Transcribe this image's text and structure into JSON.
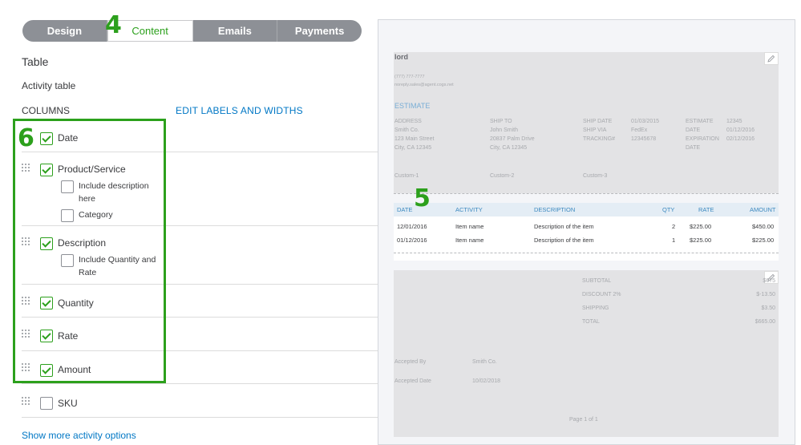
{
  "tabs": [
    {
      "label": "Design"
    },
    {
      "label": "Content"
    },
    {
      "label": "Emails"
    },
    {
      "label": "Payments"
    }
  ],
  "callouts": {
    "tabs": "4",
    "table_preview": "5",
    "columns": "6"
  },
  "left": {
    "section_title": "Table",
    "subsection": "Activity table",
    "columns_header": "COLUMNS",
    "edit_link": "EDIT LABELS AND WIDTHS",
    "columns": [
      {
        "label": "Date",
        "checked": true
      },
      {
        "label": "Product/Service",
        "checked": true,
        "sub": [
          {
            "label": "Include description here",
            "checked": false
          },
          {
            "label": "Category",
            "checked": false
          }
        ]
      },
      {
        "label": "Description",
        "checked": true,
        "sub": [
          {
            "label": "Include Quantity and Rate",
            "checked": false
          }
        ]
      },
      {
        "label": "Quantity",
        "checked": true
      },
      {
        "label": "Rate",
        "checked": true
      },
      {
        "label": "Amount",
        "checked": true
      },
      {
        "label": "SKU",
        "checked": false
      }
    ],
    "show_more": "Show more activity options"
  },
  "preview": {
    "company": "lord",
    "phone": "(777) 777-7777",
    "email": "noreply.sales@agent.cogs.net",
    "doc_title": "ESTIMATE",
    "address": {
      "label": "ADDRESS",
      "lines": [
        "Smith Co.",
        "123 Main Street",
        "City, CA 12345"
      ]
    },
    "ship_to": {
      "label": "SHIP TO",
      "lines": [
        "John Smith",
        "20837 Palm Drive",
        "City, CA 12345"
      ]
    },
    "ship_fields": [
      {
        "label": "SHIP DATE",
        "value": "01/03/2015"
      },
      {
        "label": "SHIP VIA",
        "value": "FedEx"
      },
      {
        "label": "TRACKING#",
        "value": "12345678"
      }
    ],
    "estimate_fields": [
      {
        "label": "ESTIMATE",
        "value": "12345"
      },
      {
        "label": "DATE",
        "value": "01/12/2016"
      },
      {
        "label": "EXPIRATION",
        "value": "02/12/2016"
      },
      {
        "label": "DATE",
        "value": ""
      }
    ],
    "custom": [
      "Custom-1",
      "Custom-2",
      "Custom-3"
    ],
    "table_headers": [
      "DATE",
      "ACTIVITY",
      "DESCRIPTION",
      "QTY",
      "RATE",
      "AMOUNT"
    ],
    "rows": [
      [
        "12/01/2016",
        "Item name",
        "Description of the item",
        "2",
        "$225.00",
        "$450.00"
      ],
      [
        "01/12/2016",
        "Item name",
        "Description of the item",
        "1",
        "$225.00",
        "$225.00"
      ]
    ],
    "totals": [
      {
        "label": "SUBTOTAL",
        "value": "$675"
      },
      {
        "label": "DISCOUNT 2%",
        "value": "$-13.50"
      },
      {
        "label": "SHIPPING",
        "value": "$3.50"
      },
      {
        "label": "TOTAL",
        "value": "$665.00"
      }
    ],
    "accepted_by": {
      "label": "Accepted By",
      "value": "Smith Co."
    },
    "accepted_date": {
      "label": "Accepted Date",
      "value": "10/02/2018"
    },
    "page": "Page 1 of 1"
  },
  "colors": {
    "accent": "#2ca01c",
    "link": "#0077c5",
    "tab_bg": "#8d9096",
    "table_header": "#3b88bf"
  }
}
